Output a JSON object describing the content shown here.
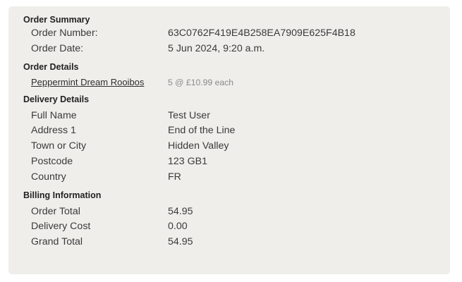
{
  "summary": {
    "title": "Order Summary",
    "order_number_label": "Order Number:",
    "order_number": "63C0762F419E4B258EA7909E625F4B18",
    "order_date_label": "Order Date:",
    "order_date": "5 Jun 2024, 9:20 a.m."
  },
  "details": {
    "title": "Order Details",
    "items": [
      {
        "name": "Peppermint Dream Rooibos",
        "qty_price": "5 @ £10.99 each"
      }
    ]
  },
  "delivery": {
    "title": "Delivery Details",
    "rows": [
      {
        "label": "Full Name",
        "value": "Test User"
      },
      {
        "label": "Address 1",
        "value": "End of the Line"
      },
      {
        "label": "Town or City",
        "value": "Hidden Valley"
      },
      {
        "label": "Postcode",
        "value": "123 GB1"
      },
      {
        "label": "Country",
        "value": "FR"
      }
    ]
  },
  "billing": {
    "title": "Billing Information",
    "rows": [
      {
        "label": "Order Total",
        "value": "54.95"
      },
      {
        "label": "Delivery Cost",
        "value": "0.00"
      },
      {
        "label": "Grand Total",
        "value": "54.95"
      }
    ]
  }
}
